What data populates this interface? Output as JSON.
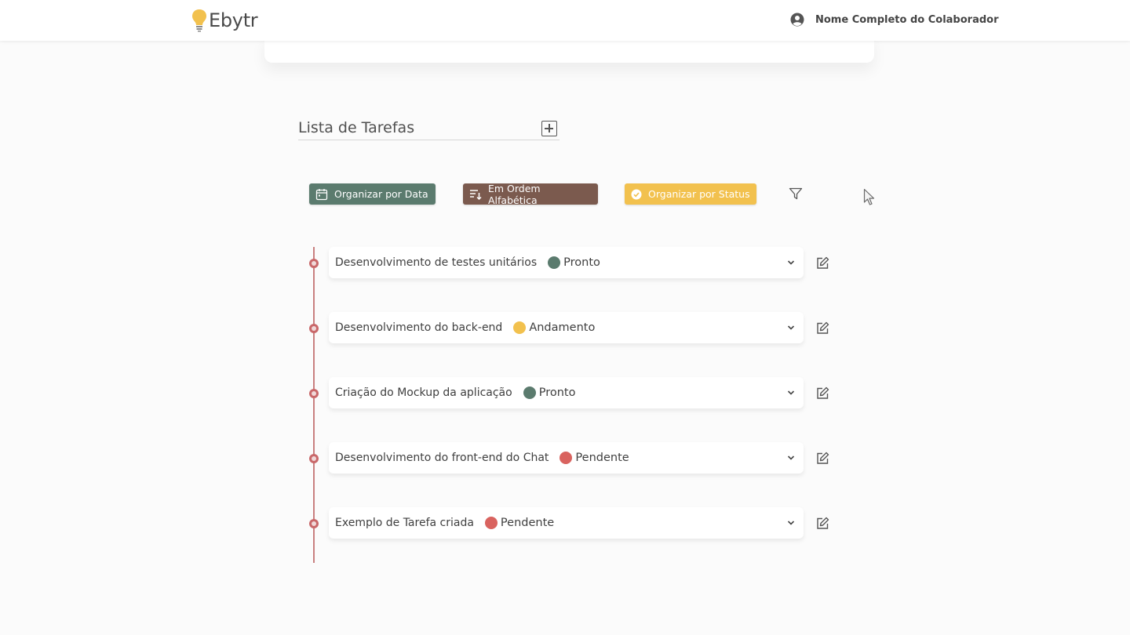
{
  "header": {
    "logo_text": "Ebytr",
    "user_name": "Nome Completo do Colaborador",
    "user_icon": "user-circle-icon",
    "logo_icon": "lightbulb-icon"
  },
  "list": {
    "title": "Lista de Tarefas",
    "add_icon": "plus-square-icon"
  },
  "sort_buttons": {
    "date_label": "Organizar por Data",
    "alpha_label": "Em Ordem Alfabética",
    "status_label": "Organizar por Status",
    "filter_icon": "filter-icon"
  },
  "colors": {
    "date": "#5b7b6e",
    "alpha": "#7b5a4e",
    "status": "#f2c14e",
    "pronto": "#5b7b6e",
    "andamento": "#f2c14e",
    "pendente": "#d9635f",
    "timeline": "#c98080"
  },
  "tasks": [
    {
      "title": "Desenvolvimento de testes unitários",
      "status": "Pronto",
      "color": "#5b7b6e"
    },
    {
      "title": "Desenvolvimento do back-end",
      "status": "Andamento",
      "color": "#f2c14e"
    },
    {
      "title": "Criação do Mockup da aplicação",
      "status": "Pronto",
      "color": "#5b7b6e"
    },
    {
      "title": "Desenvolvimento do front-end do Chat",
      "status": "Pendente",
      "color": "#d9635f"
    },
    {
      "title": "Exemplo de Tarefa criada",
      "status": "Pendente",
      "color": "#d9635f"
    }
  ]
}
